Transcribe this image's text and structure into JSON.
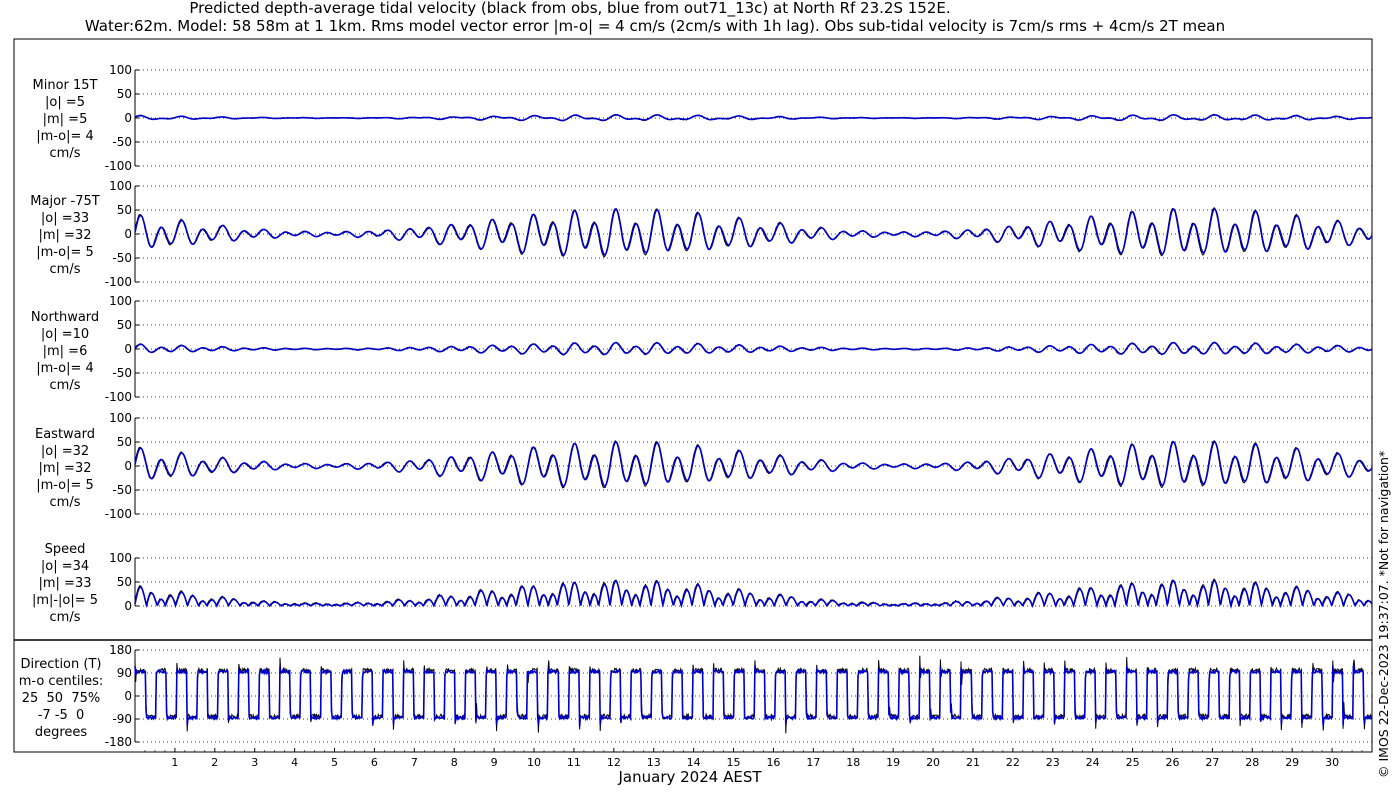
{
  "title_line1": "Predicted depth-average tidal velocity (black from obs, blue from out71_13c) at North Rf 23.2S 152E.",
  "title_line2": "Water:62m. Model: 58 58m at 1 1km. Rms model vector error |m-o| = 4 cm/s (2cm/s with 1h lag). Obs sub-tidal velocity is 7cm/s rms + 4cm/s 2T mean",
  "copyright": "© IMOS 22-Dec-2023 19:37:07. *Not for navigation*",
  "colors": {
    "observed": "#000000",
    "model": "#0000cc",
    "grid": "#000000"
  },
  "chart_data": {
    "type": "line",
    "xlabel": "January 2024 AEST",
    "x_ticks": [
      "1",
      "2",
      "3",
      "4",
      "5",
      "6",
      "7",
      "8",
      "9",
      "10",
      "11",
      "12",
      "13",
      "14",
      "15",
      "16",
      "17",
      "18",
      "19",
      "20",
      "21",
      "22",
      "23",
      "24",
      "25",
      "26",
      "27",
      "28",
      "29",
      "30"
    ],
    "xlim_days": [
      0,
      31
    ],
    "series_names": [
      "obs",
      "out71_13c"
    ],
    "panels": [
      {
        "id": "minor",
        "label_lines": [
          "Minor 15T",
          "|o| =5",
          "|m| =5",
          "|m-o|= 4",
          "cm/s"
        ],
        "ylim": [
          -100,
          100
        ],
        "yticks": [
          "100",
          "50",
          "0",
          "-50",
          "-100"
        ],
        "ytick_values": [
          100,
          50,
          0,
          -50,
          -100
        ],
        "amplitude_cm_s": 7,
        "diurnal_fraction": 0.6,
        "offset_cm_s": 0
      },
      {
        "id": "major",
        "label_lines": [
          "Major -75T",
          "|o| =33",
          "|m| =32",
          "|m-o|= 5",
          "cm/s"
        ],
        "ylim": [
          -100,
          100
        ],
        "yticks": [
          "100",
          "50",
          "0",
          "-50",
          "-100"
        ],
        "ytick_values": [
          100,
          50,
          0,
          -50,
          -100
        ],
        "amplitude_cm_s": 55,
        "diurnal_fraction": 0.3,
        "offset_cm_s": 0
      },
      {
        "id": "northward",
        "label_lines": [
          "Northward",
          "|o| =10",
          "|m| =6",
          "|m-o|= 4",
          "cm/s"
        ],
        "ylim": [
          -100,
          100
        ],
        "yticks": [
          "100",
          "50",
          "0",
          "-50",
          "-100"
        ],
        "ytick_values": [
          100,
          50,
          0,
          -50,
          -100
        ],
        "amplitude_cm_s": 14,
        "diurnal_fraction": 0.3,
        "offset_cm_s": 0
      },
      {
        "id": "eastward",
        "label_lines": [
          "Eastward",
          "|o| =32",
          "|m| =32",
          "|m-o|= 5",
          "cm/s"
        ],
        "ylim": [
          -100,
          100
        ],
        "yticks": [
          "100",
          "50",
          "0",
          "-50",
          "-100"
        ],
        "ytick_values": [
          100,
          50,
          0,
          -50,
          -100
        ],
        "amplitude_cm_s": 53,
        "diurnal_fraction": 0.3,
        "offset_cm_s": 0
      },
      {
        "id": "speed",
        "label_lines": [
          "Speed",
          "|o| =34",
          "|m| =33",
          "|m|-|o|= 5",
          "cm/s"
        ],
        "ylim": [
          0,
          100
        ],
        "yticks": [
          "100",
          "50",
          "0"
        ],
        "ytick_values": [
          100,
          50,
          0
        ],
        "amplitude_cm_s": 55,
        "diurnal_fraction": 0.3,
        "offset_cm_s": 0
      },
      {
        "id": "direction",
        "label_lines": [
          "Direction (T)",
          "m-o centiles:",
          "25  50  75%",
          "-7 -5  0",
          "degrees"
        ],
        "ylim": [
          -180,
          180
        ],
        "yticks": [
          "180",
          "90",
          "0",
          "-90",
          "-180"
        ],
        "ytick_values": [
          180,
          90,
          0,
          -90,
          -180
        ],
        "plateau_high_deg": 100,
        "plateau_low_deg": -80
      }
    ]
  }
}
